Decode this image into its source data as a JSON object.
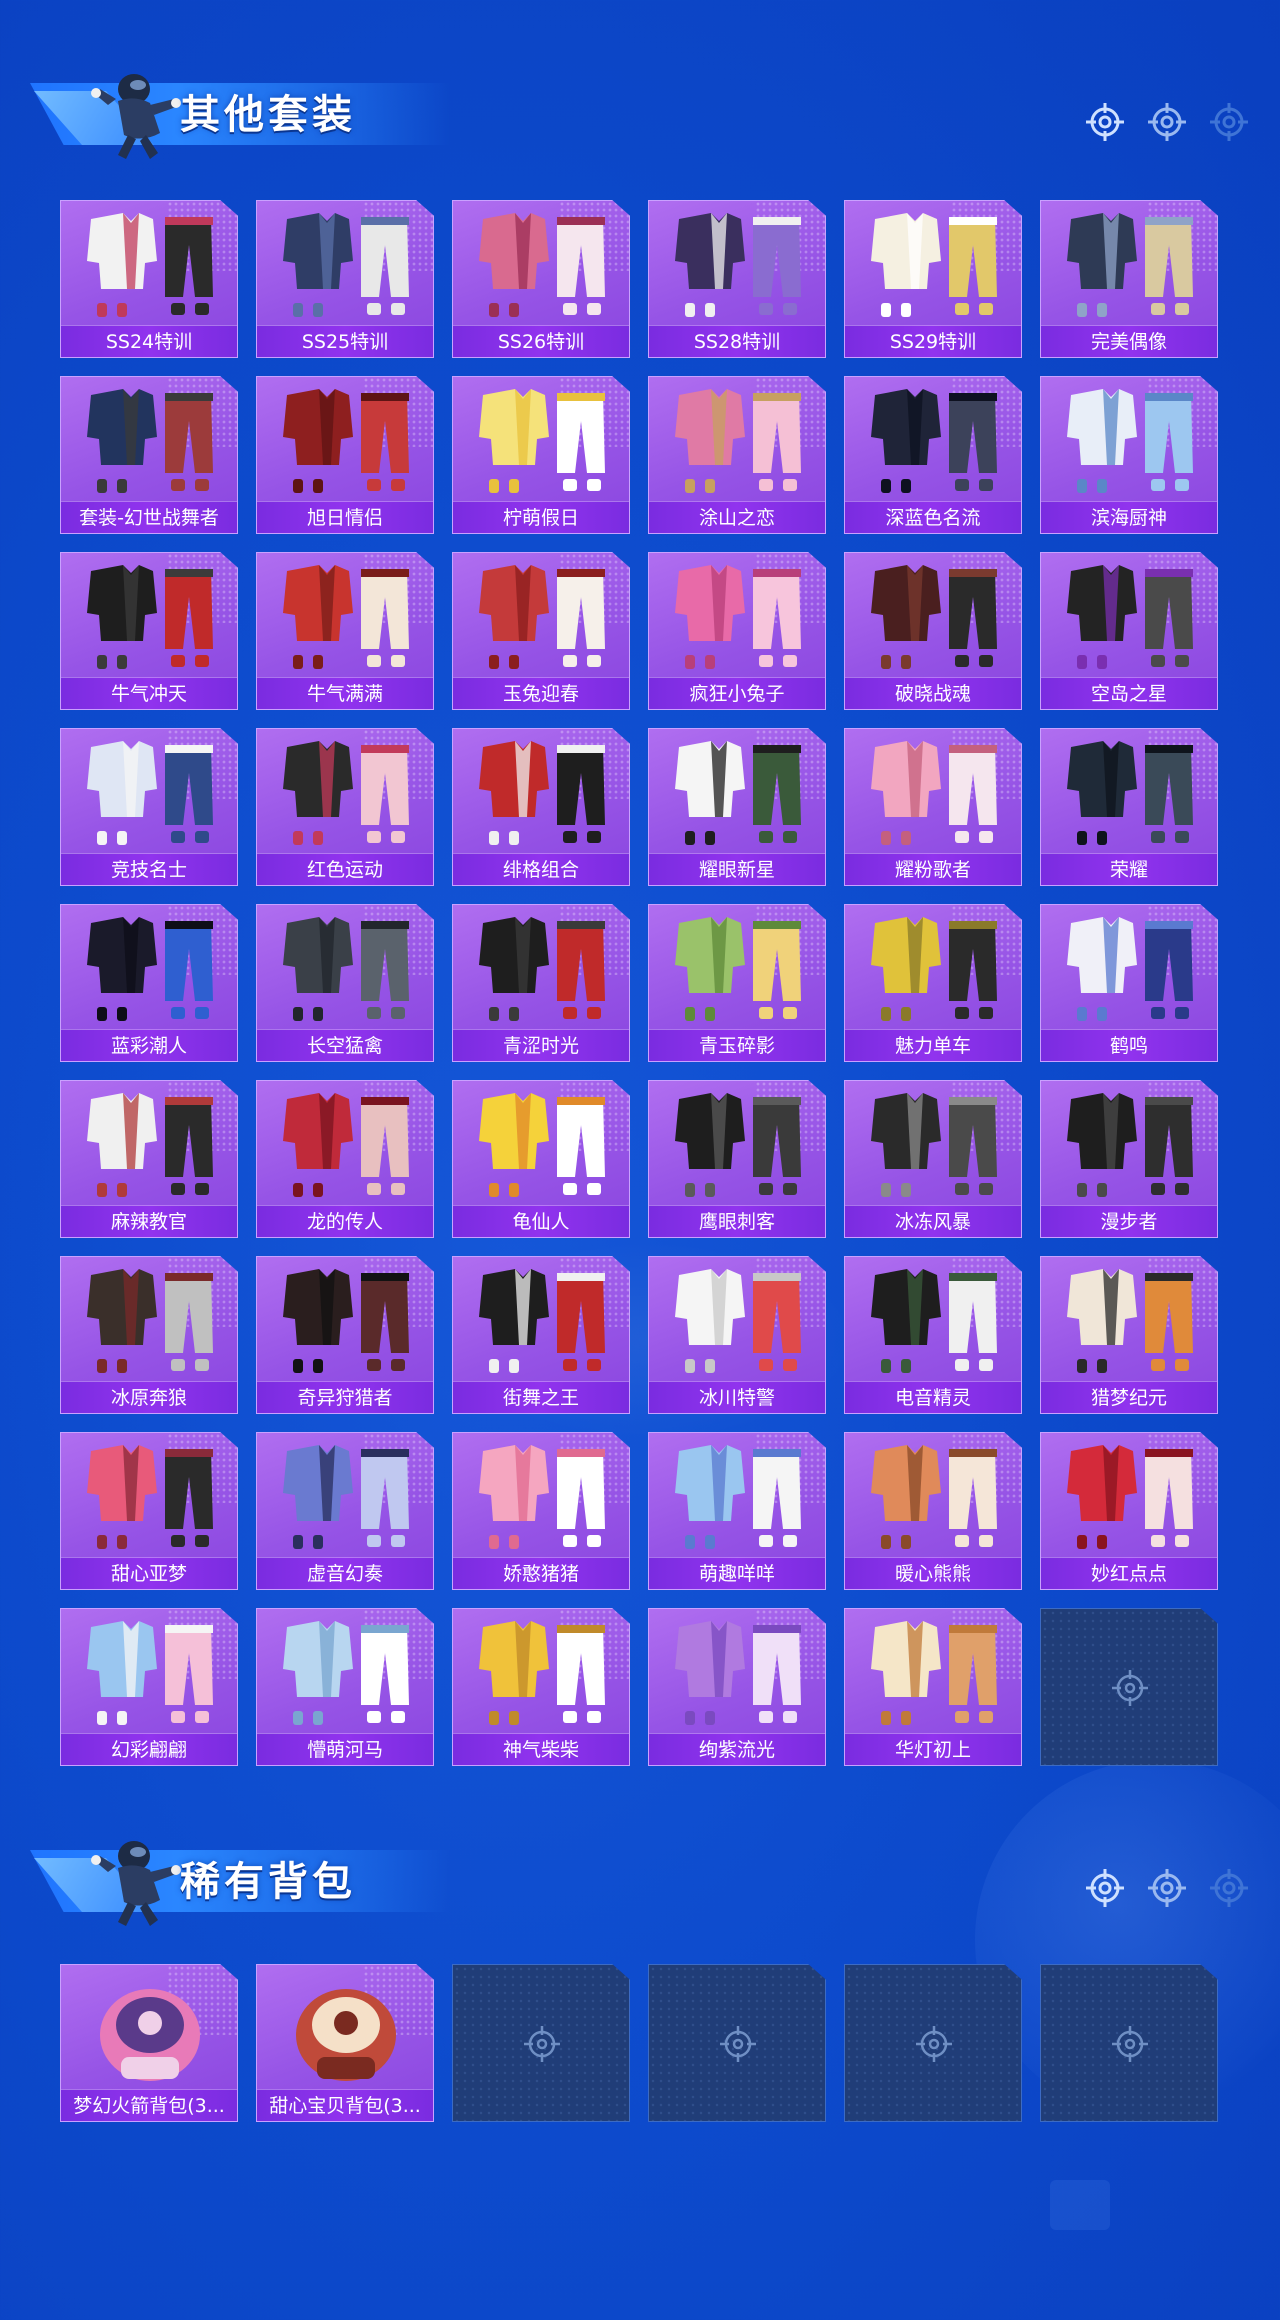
{
  "sections": {
    "outfits": {
      "title": "其他套装",
      "items": [
        "SS24特训",
        "SS25特训",
        "SS26特训",
        "SS28特训",
        "SS29特训",
        "完美偶像",
        "套装-幻世战舞者",
        "旭日情侣",
        "柠萌假日",
        "涂山之恋",
        "深蓝色名流",
        "滨海厨神",
        "牛气冲天",
        "牛气满满",
        "玉兔迎春",
        "疯狂小兔子",
        "破晓战魂",
        "空岛之星",
        "竞技名士",
        "红色运动",
        "绯格组合",
        "耀眼新星",
        "耀粉歌者",
        "荣耀",
        "蓝彩潮人",
        "长空猛禽",
        "青涩时光",
        "青玉碎影",
        "魅力单车",
        "鹤鸣",
        "麻辣教官",
        "龙的传人",
        "龟仙人",
        "鹰眼刺客",
        "冰冻风暴",
        "漫步者",
        "冰原奔狼",
        "奇异狩猎者",
        "街舞之王",
        "冰川特警",
        "电音精灵",
        "猎梦纪元",
        "甜心亚梦",
        "虚音幻奏",
        "娇憨猪猪",
        "萌趣咩咩",
        "暖心熊熊",
        "妙红点点",
        "幻彩翩翩",
        "懵萌河马",
        "神气柴柴",
        "绚紫流光",
        "华灯初上"
      ],
      "empty_slots": 1
    },
    "backpacks": {
      "title": "稀有背包",
      "items": [
        "梦幻火箭背包(3...",
        "甜心宝贝背包(3..."
      ],
      "empty_slots": 4
    }
  },
  "icons": {
    "header_mascot": "skydiver-icon",
    "nav": [
      "crosshair-icon",
      "crosshair-icon",
      "crosshair-icon"
    ],
    "empty_slot": "crosshair-icon"
  },
  "colors": {
    "background": "#0d4bcd",
    "card": "#9654e6",
    "card_label": "#8a30eb",
    "empty_slot": "#203d78",
    "title_text": "#ffffff"
  }
}
